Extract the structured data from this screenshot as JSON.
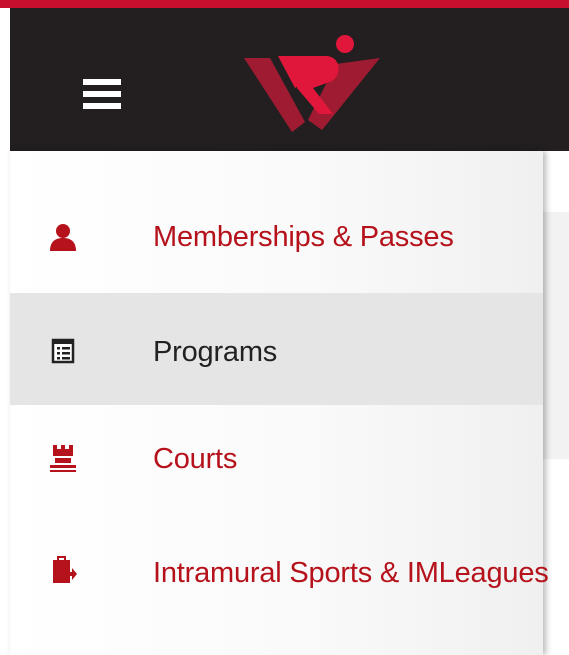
{
  "colors": {
    "accent": "#c8102e",
    "header_background": "#231f20",
    "menu_text": "#b5121b",
    "active_text": "#222222",
    "active_background": "#e5e5e5"
  },
  "header": {
    "menu_icon": "hamburger-menu-icon",
    "logo_icon": "brand-logo"
  },
  "nav": {
    "items": [
      {
        "label": "Memberships & Passes",
        "icon": "person-icon",
        "active": false
      },
      {
        "label": "Programs",
        "icon": "list-icon",
        "active": true
      },
      {
        "label": "Courts",
        "icon": "court-icon",
        "active": false
      },
      {
        "label": "Intramural Sports & IMLeagues",
        "icon": "clipboard-icon",
        "active": false
      }
    ]
  }
}
